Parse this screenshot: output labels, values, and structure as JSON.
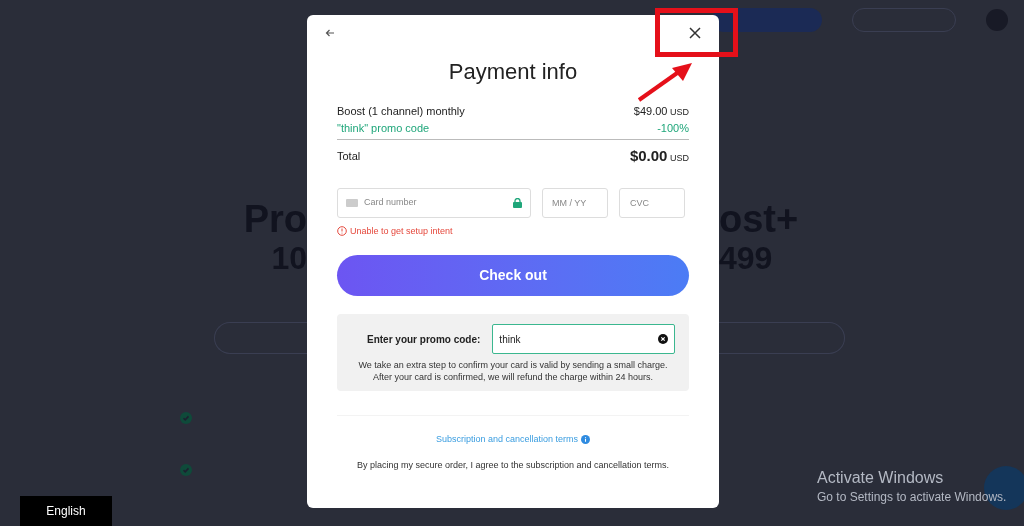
{
  "plans": [
    {
      "title": "Pro",
      "price": "10"
    },
    {
      "title": "ost+",
      "price": "499"
    }
  ],
  "modal": {
    "title": "Payment info",
    "line_items": [
      {
        "kind": "item",
        "label": "Boost (1 channel) monthly",
        "amount": "$49.00",
        "currency": "USD"
      },
      {
        "kind": "promo",
        "label": "\"think\" promo code",
        "amount": "-100%"
      }
    ],
    "total": {
      "label": "Total",
      "amount": "$0.00",
      "currency": "USD"
    },
    "card_fields": {
      "card_number_placeholder": "Card number",
      "expiry_placeholder": "MM / YY",
      "cvc_placeholder": "CVC"
    },
    "error": "Unable to get setup intent",
    "checkout_button": "Check out",
    "promo": {
      "label": "Enter your promo code:",
      "value": "think"
    },
    "note": "We take an extra step to confirm your card is valid by sending a small charge. After your card is confirmed, we will refund the charge within 24 hours.",
    "terms_link": "Subscription and cancellation terms",
    "agreement": "By placing my secure order, I agree to the subscription and cancellation terms."
  },
  "language": "English",
  "os_notice": {
    "title": "Activate Windows",
    "subtitle": "Go to Settings to activate Windows."
  }
}
